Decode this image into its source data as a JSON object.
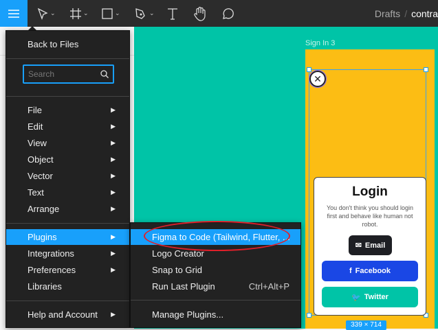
{
  "toolbar": {
    "tools": [
      {
        "name": "move-tool",
        "icon": "pointer-icon",
        "has_caret": true
      },
      {
        "name": "frame-tool",
        "icon": "frame-icon",
        "has_caret": true
      },
      {
        "name": "shape-tool",
        "icon": "rectangle-icon",
        "has_caret": true
      },
      {
        "name": "pen-tool",
        "icon": "pen-icon",
        "has_caret": true
      },
      {
        "name": "text-tool",
        "icon": "text-icon",
        "has_caret": false
      },
      {
        "name": "hand-tool",
        "icon": "hand-icon",
        "has_caret": false
      },
      {
        "name": "comment-tool",
        "icon": "comment-icon",
        "has_caret": false
      }
    ],
    "breadcrumb": {
      "folder": "Drafts",
      "separator": "/",
      "file": "contra"
    }
  },
  "main_menu": {
    "back": "Back to Files",
    "search_placeholder": "Search",
    "groups": [
      [
        "File",
        "Edit",
        "View",
        "Object",
        "Vector",
        "Text",
        "Arrange"
      ],
      [
        "Plugins",
        "Integrations",
        "Preferences",
        "Libraries"
      ],
      [
        "Help and Account"
      ]
    ],
    "items": {
      "file": "File",
      "edit": "Edit",
      "view": "View",
      "object": "Object",
      "vector": "Vector",
      "text": "Text",
      "arrange": "Arrange",
      "plugins": "Plugins",
      "integrations": "Integrations",
      "preferences": "Preferences",
      "libraries": "Libraries",
      "help": "Help and Account"
    }
  },
  "plugins_menu": {
    "figma_to_code": "Figma to Code (Tailwind, Flutter, ...",
    "logo_creator": "Logo Creator",
    "snap_to_grid": "Snap to Grid",
    "run_last": "Run Last Plugin",
    "run_last_shortcut": "Ctrl+Alt+P",
    "manage": "Manage Plugins..."
  },
  "canvas": {
    "frame_label": "Sign In 3",
    "size_badge": "339 × 714",
    "card": {
      "title": "Login",
      "text": "You don't think you should login first and behave like human not robot.",
      "email": "Email",
      "facebook": "Facebook",
      "twitter": "Twitter"
    }
  },
  "colors": {
    "accent": "#18a0fb",
    "canvas": "#00c4a7",
    "frame": "#fcbd14",
    "facebook": "#1a47e5",
    "twitter": "#00c4a7",
    "annotation": "#e0202a"
  }
}
